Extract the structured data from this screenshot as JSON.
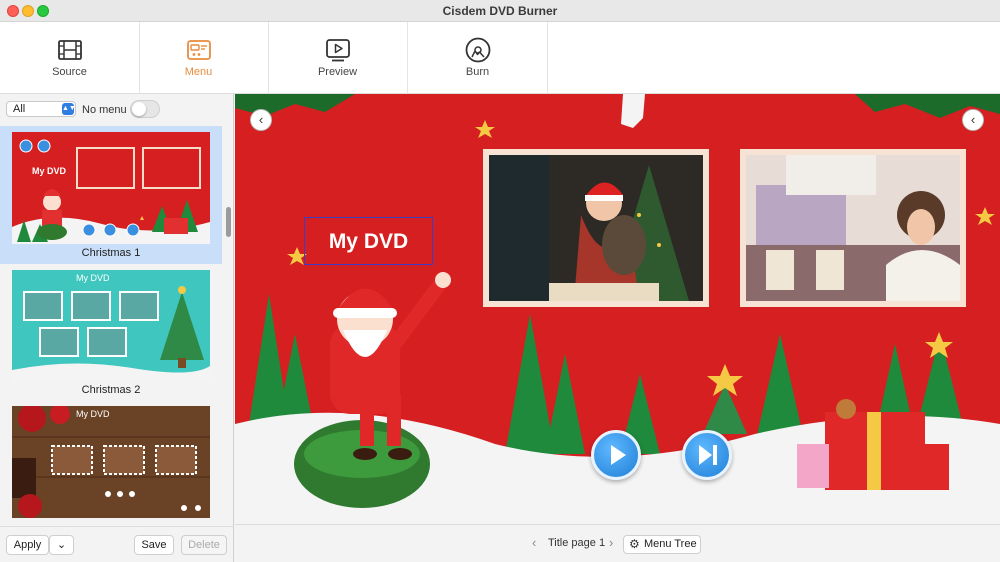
{
  "window": {
    "title": "Cisdem DVD Burner"
  },
  "toolbar": {
    "tabs": [
      {
        "label": "Source",
        "icon": "film-icon"
      },
      {
        "label": "Menu",
        "icon": "menu-template-icon",
        "active": true
      },
      {
        "label": "Preview",
        "icon": "play-preview-icon"
      },
      {
        "label": "Burn",
        "icon": "disc-burn-icon"
      }
    ],
    "accent": "#e98b3d"
  },
  "sidebar": {
    "filter": {
      "value": "All"
    },
    "no_menu_label": "No menu",
    "no_menu_on": false,
    "templates": [
      {
        "name": "Christmas 1",
        "selected": true,
        "thumb_title": "My DVD"
      },
      {
        "name": "Christmas 2",
        "selected": false,
        "thumb_title": "My DVD"
      },
      {
        "name": "",
        "selected": false,
        "thumb_title": "My DVD"
      }
    ],
    "apply_label": "Apply",
    "save_label": "Save",
    "delete_label": "Delete"
  },
  "canvas": {
    "title_text": "My DVD",
    "background": "#d51f21"
  },
  "bottombar": {
    "page_label": "Title page 1",
    "menu_tree_label": "Menu Tree"
  }
}
